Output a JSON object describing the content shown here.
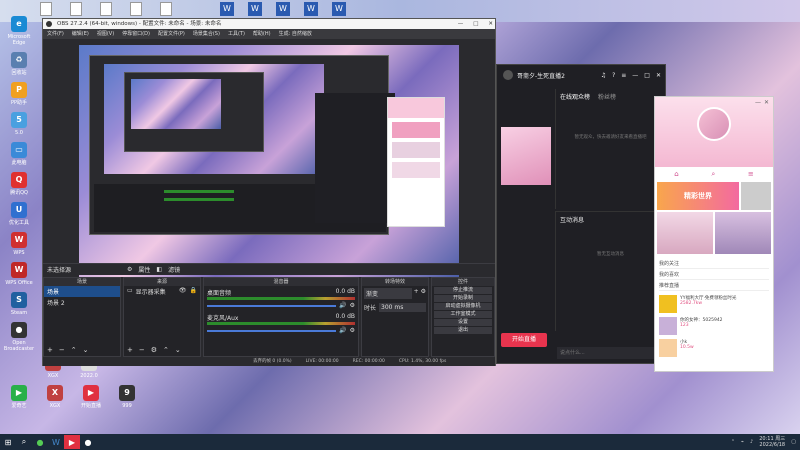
{
  "desktop": {
    "icons": [
      {
        "label": "Microsoft Edge",
        "icon": "edge-icon",
        "color": "#1a8ad4"
      },
      {
        "label": "回收站",
        "icon": "recycle-bin-icon",
        "color": "#5a7fb0"
      },
      {
        "label": "PP助手",
        "icon": "app-icon",
        "color": "#f0a020"
      },
      {
        "label": "5.0",
        "icon": "app-icon",
        "color": "#4aa0e0"
      },
      {
        "label": "此电脑",
        "icon": "computer-icon",
        "color": "#3a8ad8"
      },
      {
        "label": "腾讯QQ",
        "icon": "qq-icon",
        "color": "#e03030"
      },
      {
        "label": "优化工具",
        "icon": "app-icon",
        "color": "#3070d0"
      },
      {
        "label": "WPS",
        "icon": "wps-icon",
        "color": "#d03030"
      },
      {
        "label": "WPS Office",
        "icon": "wps-icon",
        "color": "#c02828"
      },
      {
        "label": "Steam",
        "icon": "steam-icon",
        "color": "#2060a0"
      },
      {
        "label": "Open Broadcaster",
        "icon": "obs-icon",
        "color": "#333"
      },
      {
        "label": "爱奇艺",
        "icon": "video-icon",
        "color": "#28b048"
      },
      {
        "label": "XGX",
        "icon": "app-icon",
        "color": "#c04040"
      },
      {
        "label": "2022.0",
        "icon": "file-icon",
        "color": "#ddd"
      },
      {
        "label": "开始直播",
        "icon": "app-icon",
        "color": "#e03040"
      },
      {
        "label": "999",
        "icon": "app-icon",
        "color": "#333"
      }
    ],
    "top_icons": [
      "W",
      "W",
      "W",
      "W",
      "W"
    ]
  },
  "obs": {
    "title": "OBS 27.2.4 (64-bit, windows) - 配置文件: 未命名 - 场景: 未命名",
    "menu": [
      "文件(F)",
      "编辑(E)",
      "视图(V)",
      "停靠窗口(D)",
      "配置文件(P)",
      "场景集合(S)",
      "工具(T)",
      "帮助(H)",
      "生成: 自然缩放"
    ],
    "toolbar": {
      "props_label": "属性",
      "filter_label": "滤镜"
    },
    "source_hint": "未选择源",
    "scenes": {
      "title": "场景",
      "items": [
        "场景",
        "场景 2"
      ]
    },
    "sources": {
      "title": "来源",
      "items": [
        "显示器采集"
      ]
    },
    "mixer": {
      "title": "混音器",
      "channels": [
        {
          "name": "桌面音频",
          "db": "0.0 dB"
        },
        {
          "name": "麦克风/Aux",
          "db": "0.0 dB"
        }
      ]
    },
    "transitions": {
      "title": "转场特效",
      "type": "渐变",
      "duration_label": "时长",
      "duration": "300 ms"
    },
    "controls": {
      "title": "控件",
      "buttons": [
        "停止推流",
        "开始录制",
        "启动虚拟摄像机",
        "工作室模式",
        "设置",
        "退出"
      ]
    },
    "status": {
      "dropped": "丢弃的帧 0 (0.0%)",
      "live": "LIVE: 00:00:00",
      "rec": "REC: 00:00:00",
      "cpu": "CPU: 1.4%, 30.00 fps"
    }
  },
  "live_app": {
    "title": "哥斋夕-生死直播2",
    "tabs": [
      "在线观众榜",
      "粉丝榜"
    ],
    "empty_hint": "暂无观众，快去邀请好友来看直播吧",
    "interact_title": "互动消息",
    "interact_hint": "暂无互动消息",
    "start_button": "开始直播",
    "chat_placeholder": "说点什么..."
  },
  "phone": {
    "banner_text": "精彩世界",
    "list": [
      "我的关注",
      "我的喜欢",
      "推荐直播"
    ],
    "feed": [
      {
        "name": "YY福利大厅·免费领粉丝时光",
        "stat": "2582.7kw"
      },
      {
        "name": "你的女神：5025942",
        "stat": "123"
      },
      {
        "name": "小k",
        "stat": "10.5w"
      }
    ]
  },
  "taskbar": {
    "time": "20:11",
    "date": "2022/6/18",
    "weekday": "周三"
  }
}
